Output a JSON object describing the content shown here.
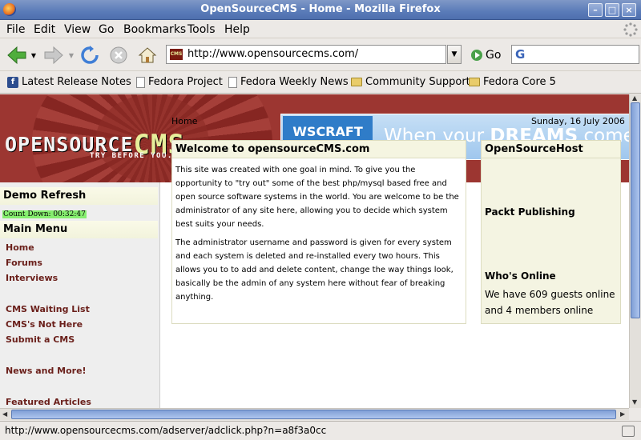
{
  "window": {
    "title": "OpenSourceCMS - Home - Mozilla Firefox",
    "minimize": "–",
    "maximize": "□",
    "close": "×"
  },
  "menu": [
    {
      "label": "File",
      "key": "F"
    },
    {
      "label": "Edit",
      "key": "E"
    },
    {
      "label": "View",
      "key": "V"
    },
    {
      "label": "Go",
      "key": "G"
    },
    {
      "label": "Bookmarks",
      "key": "B"
    },
    {
      "label": "Tools",
      "key": "T"
    },
    {
      "label": "Help",
      "key": "H"
    }
  ],
  "nav": {
    "url": "http://www.opensourcecms.com/",
    "go_label": "Go",
    "search_logo": "G"
  },
  "bookmarks": [
    {
      "label": "Latest Release Notes",
      "icon": "fedora-icon"
    },
    {
      "label": "Fedora Project",
      "icon": "page-icon"
    },
    {
      "label": "Fedora Weekly News",
      "icon": "page-icon"
    },
    {
      "label": "Community Support",
      "icon": "folder-icon"
    },
    {
      "label": "Fedora Core 5",
      "icon": "folder-icon"
    }
  ],
  "site": {
    "logo_main": "OPENSOURCE",
    "logo_accent": "CMS",
    "tagline": "TRY BEFORE YOU...INSTALL",
    "ad": {
      "brand": "WSCRAFT",
      "stars": "★★★★★",
      "slogan_pre": "When your ",
      "slogan_bold": "DREAMS",
      "slogan_post": " come tru"
    },
    "left": {
      "demo_heading": "Demo Refresh",
      "countdown": "Count Down: 00:32:47",
      "menu_heading": "Main Menu",
      "items": [
        "Home",
        "Forums",
        "Interviews",
        "CMS Waiting List",
        "CMS's Not Here",
        "Submit a CMS",
        "News and More!",
        "Featured Articles"
      ]
    },
    "breadcrumb": "Home",
    "date": "Sunday, 16 July 2006",
    "main": {
      "heading": "Welcome to opensourceCMS.com",
      "p1": "This site was created with one goal in mind. To give you the opportunity to \"try out\" some of the best php/mysql based free and open source software systems in the world. You are welcome to be the administrator of any site here, allowing you to decide which system best suits your needs.",
      "p2": "The administrator username and password is given for every system and each system is deleted and re-installed every two hours. This allows you to to add and delete content, change the way things look, basically be the admin of any system here without fear of breaking anything."
    },
    "side": {
      "h1": "OpenSourceHost",
      "h2": "Packt Publishing",
      "h3": "Who's Online",
      "online": "We have 609 guests online and 4 members online"
    }
  },
  "status": {
    "text": "http://www.opensourcecms.com/adserver/adclick.php?n=a8f3a0cc"
  }
}
